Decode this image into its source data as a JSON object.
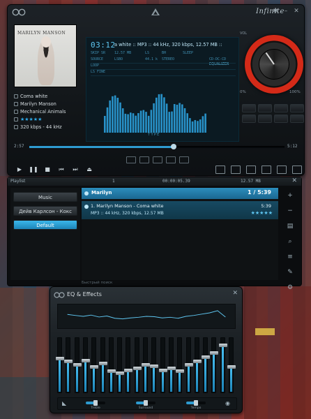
{
  "player": {
    "title": "Infinite",
    "album_art_text": "MARILYN MANSON",
    "track_meta": [
      {
        "label": "Coma white"
      },
      {
        "label": "Marilyn Manson"
      },
      {
        "label": "Mechanical Animals"
      }
    ],
    "rating": "★★★★★",
    "bitrate": "320 kbps - 44 kHz",
    "lcd": {
      "time": "03:12",
      "song_line": "a white :: MP3 :: 44 kHz, 320 kbps, 12.57 MB ::",
      "labels": [
        "SKIP SR",
        "LS",
        "BH",
        "SLEEP"
      ],
      "values": [
        "12.57 MB",
        "LSBO",
        "44.1 k",
        "STEREO",
        "CD-DC-CD"
      ],
      "left_tags": [
        "LOOP",
        "SOURCE",
        "LS FINE"
      ],
      "equalizer_label": "EQUALIZER",
      "type_label": "TYPE"
    },
    "vol_label": "VOL",
    "pct_left": "0%",
    "pct_right": "100%",
    "elapsed": "2:57",
    "total": "5:12",
    "progress_fraction": 0.565
  },
  "playlist": {
    "title": "Playlist",
    "time_info": "00:00:05.39",
    "size_info": "12.57 MB",
    "page": "1",
    "categories": [
      "Music",
      "Дейв Карлсон - Кокс",
      "Default"
    ],
    "active_category": 2,
    "group_name": "Marilyn",
    "group_count": "1 / 5:39",
    "track": {
      "title": "1. Marilyn Manson - Coma white",
      "meta": "MP3 :: 44 kHz, 320 kbps, 12.57 MB",
      "duration": "5:39",
      "rating": "★★★★★"
    },
    "footer": "Быстрый поиск"
  },
  "eq": {
    "title": "EQ & Effects",
    "bands": [
      0.62,
      0.56,
      0.5,
      0.58,
      0.46,
      0.52,
      0.38,
      0.34,
      0.4,
      0.44,
      0.5,
      0.48,
      0.4,
      0.44,
      0.38,
      0.5,
      0.56,
      0.64,
      0.72,
      0.86,
      0.46
    ],
    "sliders": [
      {
        "label": "Treble",
        "value": 0.5
      },
      {
        "label": "Surround",
        "value": 0.5
      },
      {
        "label": "Tempo",
        "value": 0.5
      }
    ]
  }
}
